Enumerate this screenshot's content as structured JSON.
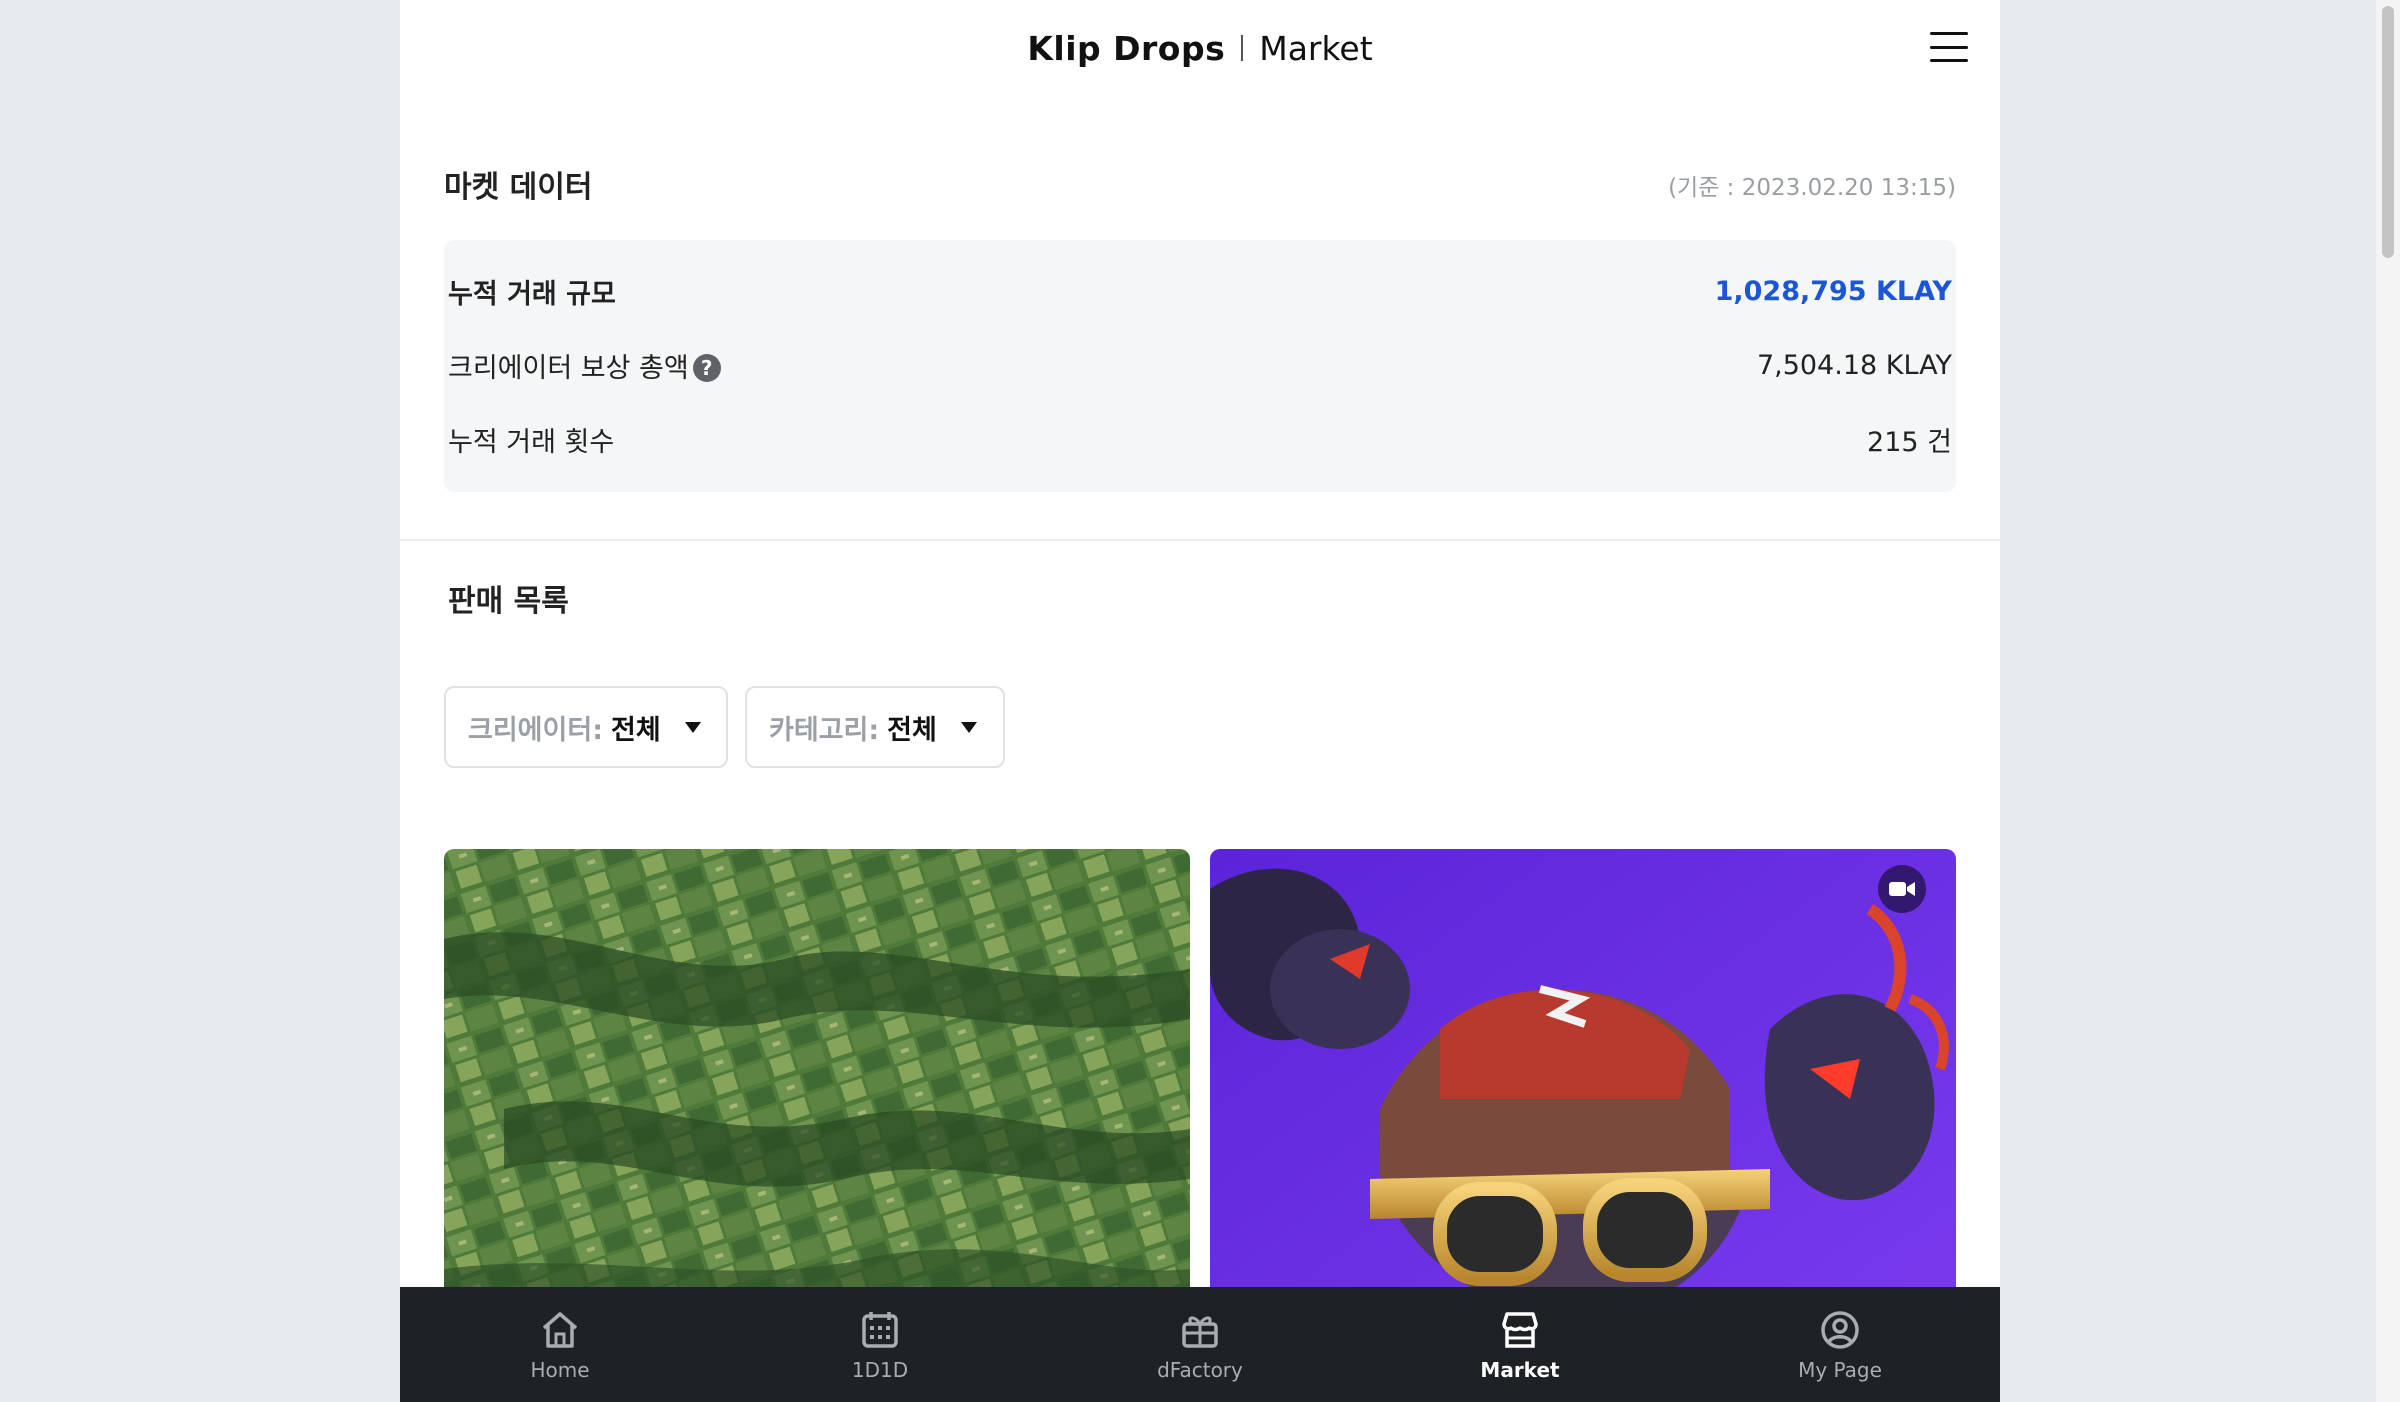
{
  "header": {
    "brand": "Klip Drops",
    "subtitle": "Market"
  },
  "market_data": {
    "title": "마켓 데이터",
    "as_of": "(기준 : 2023.02.20 13:15)",
    "stats": [
      {
        "label": "누적 거래 규모",
        "value": "1,028,795 KLAY"
      },
      {
        "label": "크리에이터 보상 총액",
        "value": "7,504.18 KLAY"
      },
      {
        "label": "누적 거래 횟수",
        "value": "215 건"
      }
    ],
    "help_symbol": "?"
  },
  "sales": {
    "title": "판매 목록",
    "filters": [
      {
        "label": "크리에이터:",
        "value": "전체"
      },
      {
        "label": "카테고리:",
        "value": "전체"
      }
    ],
    "items": [
      {
        "image": "satellite-farmland-image"
      },
      {
        "image": "demon-character-image",
        "badge": "video-icon"
      }
    ]
  },
  "nav": {
    "tabs": [
      {
        "label": "Home",
        "icon": "home-icon"
      },
      {
        "label": "1D1D",
        "icon": "calendar-icon"
      },
      {
        "label": "dFactory",
        "icon": "gift-icon"
      },
      {
        "label": "Market",
        "icon": "store-icon",
        "active": true
      },
      {
        "label": "My Page",
        "icon": "user-icon"
      }
    ]
  },
  "colors": {
    "accent": "#1b56d6",
    "tabbar_bg": "#1e2225",
    "card2_bg": "#6a2ee0"
  }
}
